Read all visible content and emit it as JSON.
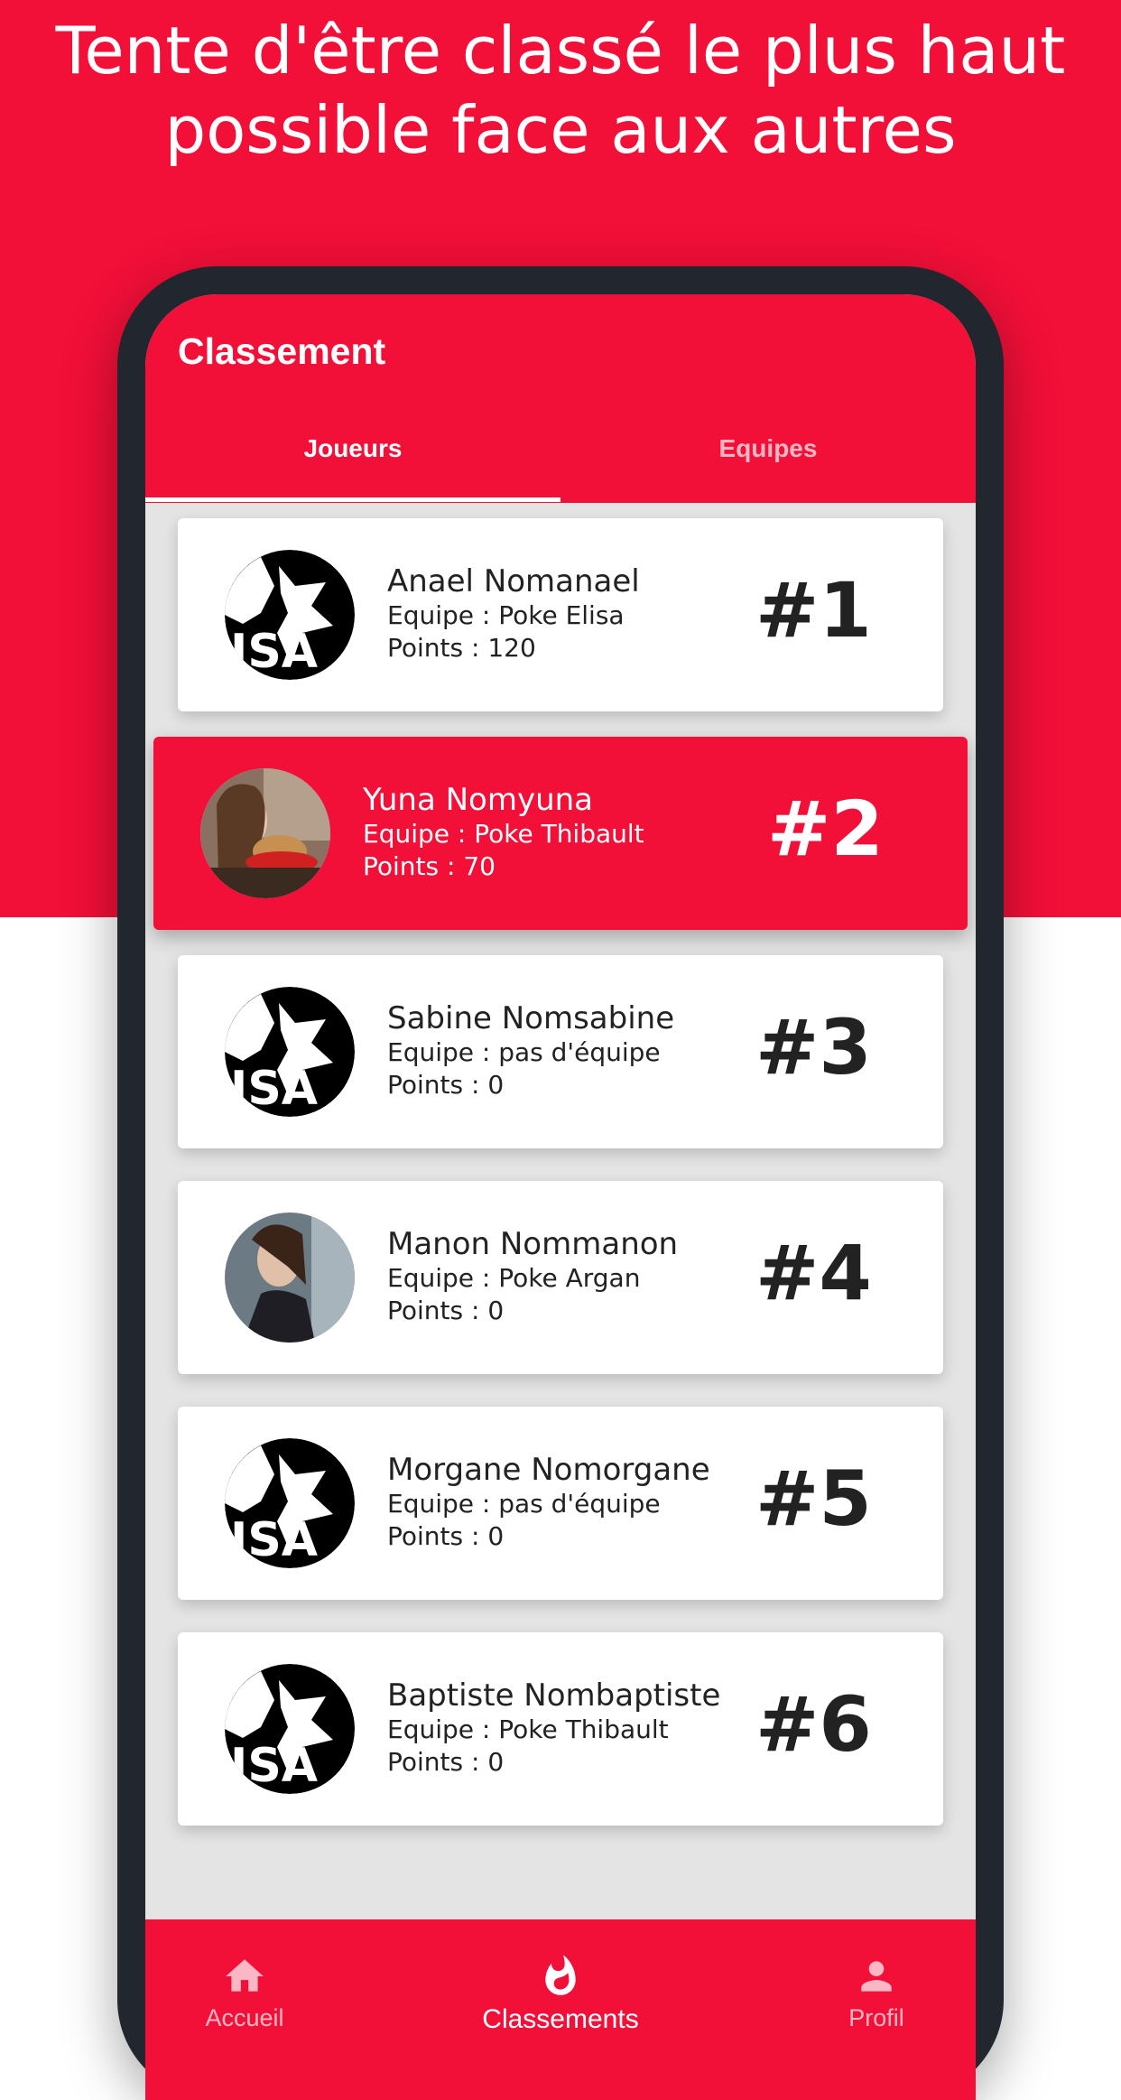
{
  "headline": {
    "line1": "Tente d'être classé le plus haut",
    "line2": "possible face aux autres"
  },
  "appbar": {
    "title": "Classement"
  },
  "tabs": [
    {
      "label": "Joueurs",
      "active": true
    },
    {
      "label": "Equipes",
      "active": false
    }
  ],
  "players": [
    {
      "name": "Anael Nomanael",
      "team": "Equipe : Poke Elisa",
      "points": "Points : 120",
      "rank": "#1",
      "avatar": "insa-wolf-logo"
    },
    {
      "name": "Yuna Nomyuna",
      "team": "Equipe : Poke Thibault",
      "points": "Points : 70",
      "rank": "#2",
      "avatar": "user-photo",
      "highlighted": true
    },
    {
      "name": "Sabine Nomsabine",
      "team": "Equipe : pas d'équipe",
      "points": "Points : 0",
      "rank": "#3",
      "avatar": "insa-wolf-logo"
    },
    {
      "name": "Manon Nommanon",
      "team": "Equipe : Poke Argan",
      "points": "Points : 0",
      "rank": "#4",
      "avatar": "user-photo"
    },
    {
      "name": "Morgane Nomorgane",
      "team": "Equipe : pas d'équipe",
      "points": "Points : 0",
      "rank": "#5",
      "avatar": "insa-wolf-logo"
    },
    {
      "name": "Baptiste Nombaptiste",
      "team": "Equipe : Poke Thibault",
      "points": "Points : 0",
      "rank": "#6",
      "avatar": "insa-wolf-logo"
    }
  ],
  "bottom_nav": [
    {
      "label": "Accueil",
      "icon": "home-icon"
    },
    {
      "label": "Classements",
      "icon": "flame-icon",
      "active": true
    },
    {
      "label": "Profil",
      "icon": "person-icon"
    }
  ],
  "colors": {
    "brand_red": "#f20f38",
    "phone_frame": "#22262e"
  }
}
